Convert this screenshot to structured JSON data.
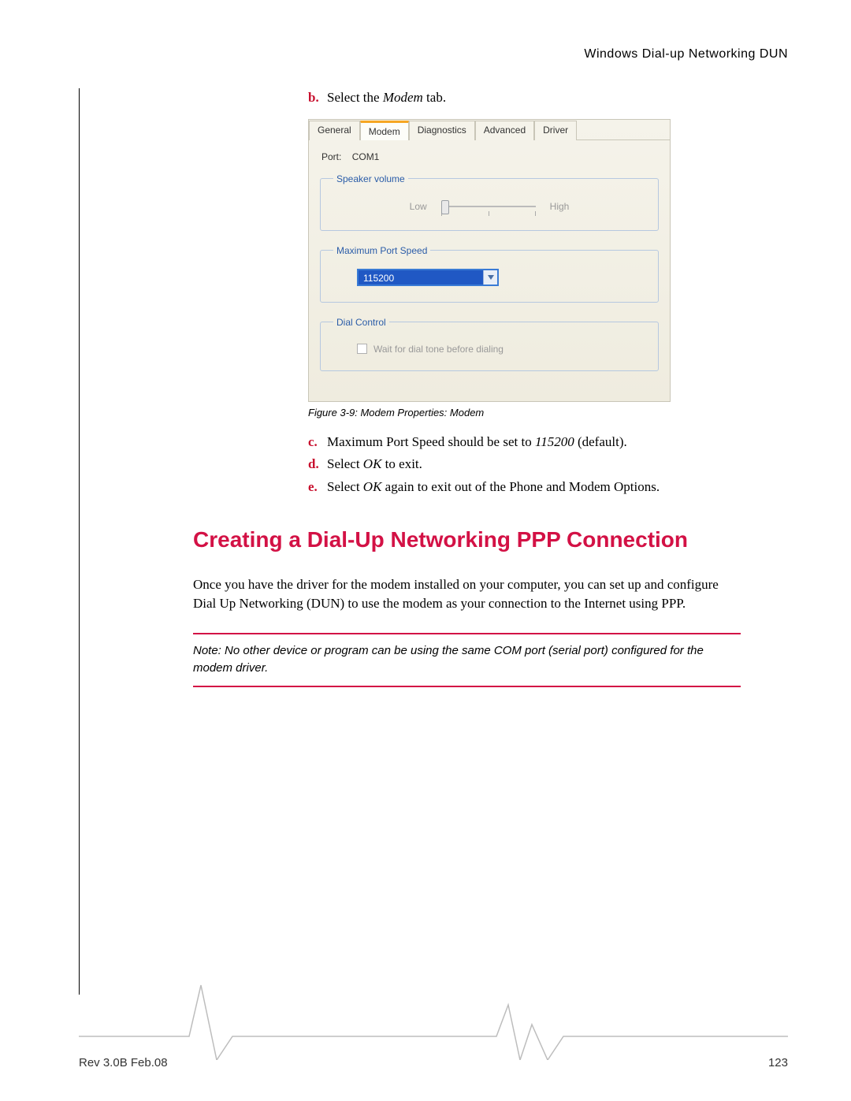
{
  "header": {
    "title": "Windows Dial-up Networking DUN"
  },
  "steps_top": {
    "b": {
      "marker": "b.",
      "pre": "Select the ",
      "ital": "Modem",
      "post": " tab."
    }
  },
  "dialog": {
    "tabs": {
      "t0": "General",
      "t1": "Modem",
      "t2": "Diagnostics",
      "t3": "Advanced",
      "t4": "Driver"
    },
    "port_label": "Port:",
    "port_value": "COM1",
    "group_speaker": "Speaker volume",
    "speaker_low": "Low",
    "speaker_high": "High",
    "group_speed": "Maximum Port Speed",
    "speed_value": "115200",
    "group_dial": "Dial Control",
    "dial_wait": "Wait for dial tone before dialing"
  },
  "figure_caption": "Figure 3-9: Modem Properties: Modem",
  "steps_bottom": {
    "c": {
      "marker": "c.",
      "pre": "Maximum Port Speed should be set to ",
      "ital": "115200",
      "post": " (default)."
    },
    "d": {
      "marker": "d.",
      "pre": "Select ",
      "ital": "OK",
      "post": " to exit."
    },
    "e": {
      "marker": "e.",
      "pre": "Select ",
      "ital": "OK",
      "post": " again to exit out of the Phone and Modem Options."
    }
  },
  "section_heading": "Creating a Dial-Up Networking PPP Connection",
  "paragraph": "Once you have the driver for the modem installed on your computer, you can set up and configure Dial Up Networking (DUN) to use the modem as your connection to the Internet using PPP.",
  "note": "Note: No other device or program can be using the same COM port (serial port) configured for the modem driver.",
  "footer": {
    "rev": "Rev 3.0B Feb.08",
    "page": "123"
  }
}
